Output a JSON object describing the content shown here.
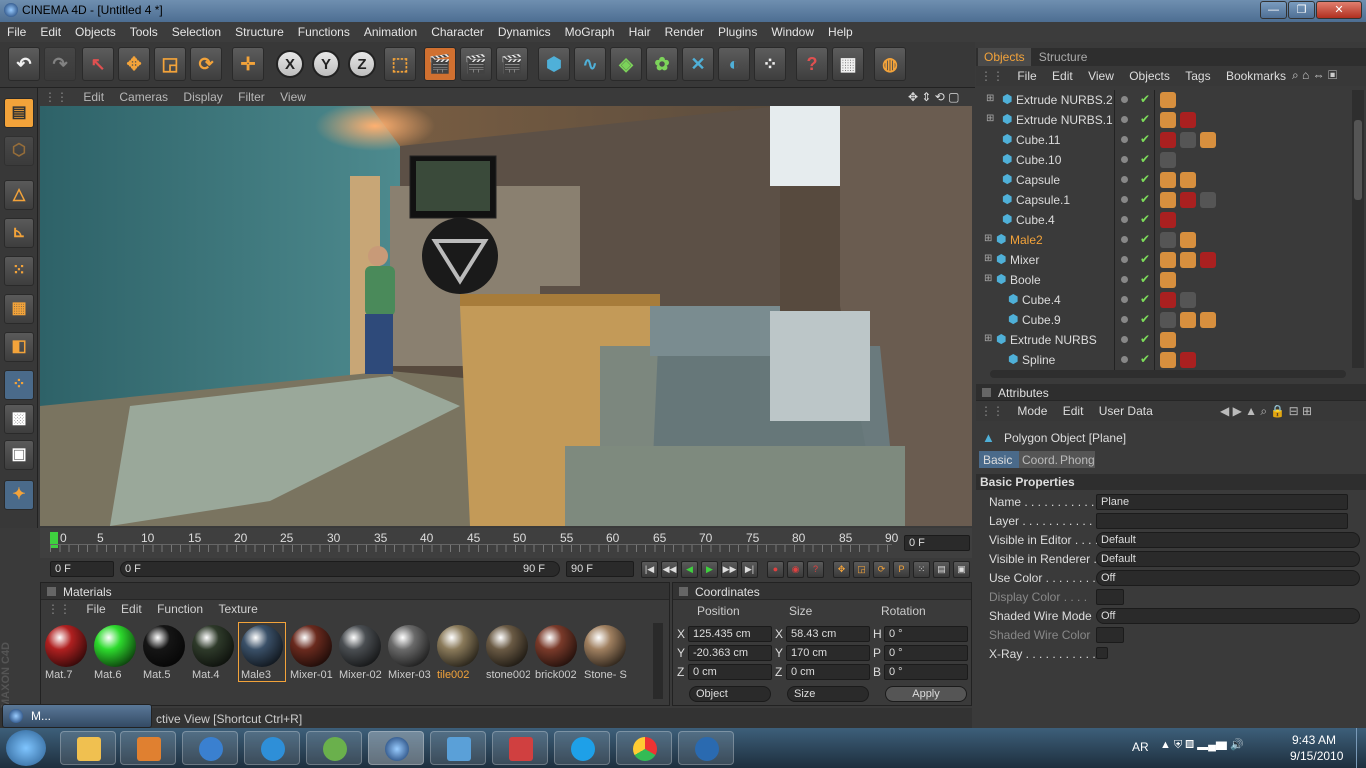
{
  "window": {
    "title": "CINEMA 4D - [Untitled 4 *]",
    "minimize": "—",
    "restore": "❐",
    "close": "✕"
  },
  "menu": [
    "File",
    "Edit",
    "Objects",
    "Tools",
    "Selection",
    "Structure",
    "Functions",
    "Animation",
    "Character",
    "Dynamics",
    "MoGraph",
    "Hair",
    "Render",
    "Plugins",
    "Window",
    "Help"
  ],
  "viewport": {
    "menu": [
      "Edit",
      "Cameras",
      "Display",
      "Filter",
      "View"
    ],
    "nav_icons": "✥ ⇕ ⟲ ▢"
  },
  "timeline": {
    "ticks": [
      "0",
      "5",
      "10",
      "15",
      "20",
      "25",
      "30",
      "35",
      "40",
      "45",
      "50",
      "55",
      "60",
      "65",
      "70",
      "75",
      "80",
      "85",
      "90"
    ],
    "current_frame": "0 F",
    "start": "0 F",
    "range_start": "0 F",
    "range_end": "90 F",
    "end": "90 F"
  },
  "materials": {
    "title": "Materials",
    "menu": [
      "File",
      "Edit",
      "Function",
      "Texture"
    ],
    "items": [
      {
        "label": "Mat.7",
        "color": "#b02020"
      },
      {
        "label": "Mat.6",
        "color": "#2ddb2d"
      },
      {
        "label": "Mat.5",
        "color": "#151515"
      },
      {
        "label": "Mat.4",
        "color": "#2e3a2a"
      },
      {
        "label": "Male3",
        "color": "#3a5068"
      },
      {
        "label": "Mixer-01",
        "color": "#6a2a1e"
      },
      {
        "label": "Mixer-02",
        "color": "#4a4e52"
      },
      {
        "label": "Mixer-03",
        "color": "#6a6a6a"
      },
      {
        "label": "tile002",
        "color": "#8a7a5a"
      },
      {
        "label": "stone002",
        "color": "#6a5a44"
      },
      {
        "label": "brick002",
        "color": "#7a3a2a"
      },
      {
        "label": "Stone- S",
        "color": "#a08060"
      }
    ]
  },
  "coordinates": {
    "title": "Coordinates",
    "headers": [
      "Position",
      "Size",
      "Rotation"
    ],
    "rows": [
      {
        "axis": "X",
        "pos": "125.435 cm",
        "saxis": "X",
        "size": "58.43 cm",
        "raxis": "H",
        "rot": "0 °"
      },
      {
        "axis": "Y",
        "pos": "-20.363 cm",
        "saxis": "Y",
        "size": "170 cm",
        "raxis": "P",
        "rot": "0 °"
      },
      {
        "axis": "Z",
        "pos": "0 cm",
        "saxis": "Z",
        "size": "0 cm",
        "raxis": "B",
        "rot": "0 °"
      }
    ],
    "mode": "Object",
    "size_mode": "Size",
    "apply": "Apply"
  },
  "objects_panel": {
    "tabs": [
      "Objects",
      "Structure"
    ],
    "menu": [
      "File",
      "Edit",
      "View",
      "Objects",
      "Tags",
      "Bookmarks"
    ],
    "rows": [
      {
        "name": "Extrude NURBS.2",
        "indent": 1,
        "color": "#dcdcdc"
      },
      {
        "name": "Extrude NURBS.1",
        "indent": 1,
        "color": "#dcdcdc"
      },
      {
        "name": "Cube.11",
        "indent": 1,
        "color": "#dcdcdc"
      },
      {
        "name": "Cube.10",
        "indent": 1,
        "color": "#dcdcdc"
      },
      {
        "name": "Capsule",
        "indent": 1,
        "color": "#dcdcdc"
      },
      {
        "name": "Capsule.1",
        "indent": 1,
        "color": "#dcdcdc"
      },
      {
        "name": "Cube.4",
        "indent": 1,
        "color": "#dcdcdc"
      },
      {
        "name": "Male2",
        "indent": 0,
        "color": "#f3a33a"
      },
      {
        "name": "Mixer",
        "indent": 0,
        "color": "#dcdcdc"
      },
      {
        "name": "Boole",
        "indent": 0,
        "color": "#dcdcdc"
      },
      {
        "name": "Cube.4",
        "indent": 2,
        "color": "#dcdcdc"
      },
      {
        "name": "Cube.9",
        "indent": 2,
        "color": "#dcdcdc"
      },
      {
        "name": "Extrude NURBS",
        "indent": 0,
        "color": "#dcdcdc"
      },
      {
        "name": "Spline",
        "indent": 2,
        "color": "#dcdcdc"
      }
    ]
  },
  "attributes": {
    "title": "Attributes",
    "menu": [
      "Mode",
      "Edit",
      "User Data"
    ],
    "object": "Polygon Object [Plane]",
    "tabs": [
      "Basic",
      "Coord.",
      "Phong"
    ],
    "section": "Basic Properties",
    "fields": {
      "name_label": "Name . . . . . . . . . . . .",
      "name_value": "Plane",
      "layer_label": "Layer . . . . . . . . . . . .",
      "vis_editor_label": "Visible in Editor . . . .",
      "vis_editor_value": "Default",
      "vis_render_label": "Visible in Renderer . .",
      "vis_render_value": "Default",
      "use_color_label": "Use Color . . . . . . . .",
      "use_color_value": "Off",
      "display_color_label": "Display Color . . . .",
      "shaded_wire_label": "Shaded Wire Mode",
      "shaded_wire_value": "Off",
      "shaded_wire_color_label": "Shaded Wire Color",
      "xray_label": "X-Ray . . . . . . . . . . . ."
    }
  },
  "status": {
    "text": "ctive View [Shortcut Ctrl+R]",
    "mini_window": "M..."
  },
  "taskbar": {
    "lang": "AR",
    "time": "9:43 AM",
    "date": "9/15/2010"
  },
  "colors": {
    "accent": "#f3a33a",
    "selection": "#4a6a8a"
  }
}
